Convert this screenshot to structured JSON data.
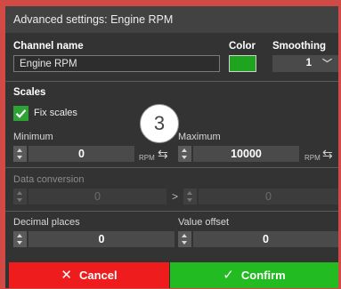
{
  "dialog": {
    "title": "Advanced settings: Engine RPM",
    "channel_name_label": "Channel name",
    "channel_name_value": "Engine RPM",
    "color_label": "Color",
    "color_value": "#1fa41f",
    "smoothing_label": "Smoothing",
    "smoothing_value": "1",
    "scales_label": "Scales",
    "fix_scales_label": "Fix scales",
    "fix_scales_checked": true,
    "step_marker": "3",
    "minimum_label": "Minimum",
    "minimum_value": "0",
    "minimum_unit": "RPM",
    "maximum_label": "Maximum",
    "maximum_value": "10000",
    "maximum_unit": "RPM",
    "data_conversion_label": "Data conversion",
    "conversion_from": "0",
    "conversion_arrow": ">",
    "conversion_to": "0",
    "decimal_places_label": "Decimal places",
    "decimal_places_value": "0",
    "value_offset_label": "Value offset",
    "value_offset_value": "0",
    "cancel_label": "Cancel",
    "confirm_label": "Confirm",
    "colors": {
      "cancel": "#ee1c1c",
      "confirm": "#22bb22",
      "frame": "#d24a45"
    }
  }
}
